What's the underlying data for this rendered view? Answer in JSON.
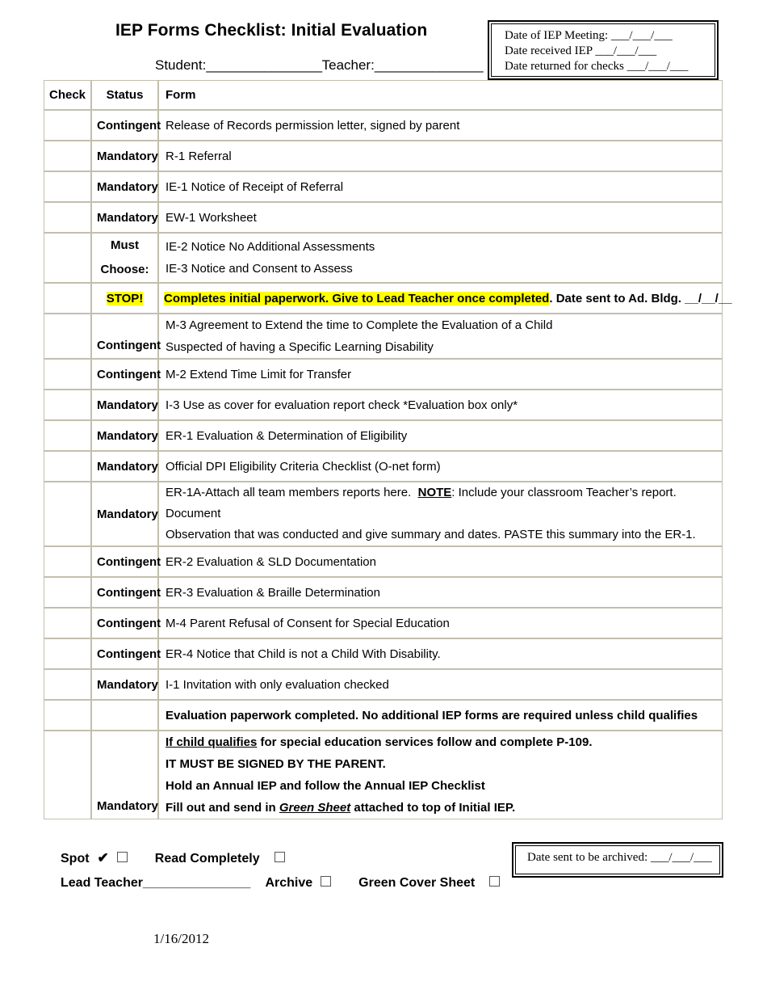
{
  "header": {
    "title": "IEP Forms Checklist: Initial Evaluation",
    "student_label": "Student:",
    "student_blank": "________________",
    "teacher_label": "Teacher:",
    "teacher_blank": "_______________"
  },
  "date_box": {
    "line1_label": "Date of IEP Meeting:",
    "line1_blank": "___/___/___",
    "line2_label": "Date received IEP",
    "line2_blank": "___/___/___",
    "line3_label": "Date returned for checks",
    "line3_blank": "___/___/___"
  },
  "table": {
    "headers": {
      "check": "Check",
      "status": "Status",
      "form": "Form"
    },
    "rows": [
      {
        "status": "Contingent",
        "form": "Release of Records permission letter, signed by parent"
      },
      {
        "status": "Mandatory",
        "form": "R-1 Referral"
      },
      {
        "status": "Mandatory",
        "form": "IE-1 Notice of Receipt of Referral"
      },
      {
        "status": "Mandatory",
        "form": "EW-1 Worksheet"
      },
      {
        "status_line1": "Must",
        "status_line2": "Choose:",
        "form_line1": "IE-2 Notice No Additional Assessments",
        "form_line2": "IE-3 Notice and Consent to Assess"
      },
      {
        "status": "STOP!",
        "form_highlight": "Completes initial paperwork. Give to Lead Teacher once completed",
        "form_tail": ". Date sent to Ad. Bldg.  __/__/__"
      },
      {
        "status": "Contingent",
        "form_line1": "M-3 Agreement to Extend the time to Complete the Evaluation of a Child",
        "form_line2": "Suspected of having a Specific Learning Disability"
      },
      {
        "status": "Contingent",
        "form": "M-2 Extend Time Limit for Transfer"
      },
      {
        "status": "Mandatory",
        "form": "I-3 Use as cover for evaluation report check *Evaluation box only*"
      },
      {
        "status": "Mandatory",
        "form": "ER-1 Evaluation & Determination of Eligibility"
      },
      {
        "status": "Mandatory",
        "form": "Official DPI Eligibility Criteria Checklist (O-net form)"
      },
      {
        "status": "Mandatory",
        "form_a1": "ER-1A-Attach all team members reports here.",
        "form_note": "NOTE",
        "form_a2": ": Include your classroom Teacher’s report.  Document",
        "form_a3": "Observation that was conducted and give summary and dates.  PASTE this summary into the ER-1."
      },
      {
        "status": "Contingent",
        "form": "ER-2 Evaluation & SLD Documentation"
      },
      {
        "status": "Contingent",
        "form": "ER-3 Evaluation & Braille Determination"
      },
      {
        "status": "Contingent",
        "form": "M-4 Parent Refusal of Consent for Special Education"
      },
      {
        "status": "Contingent",
        "form": " ER-4 Notice that Child is not a Child With Disability."
      },
      {
        "status": "Mandatory",
        "form": "I-1 Invitation with only evaluation checked"
      },
      {
        "status": "",
        "form": "Evaluation paperwork completed. No additional IEP forms are required unless child qualifies"
      },
      {
        "status": "Mandatory",
        "final_l1_u": "If child qualifies",
        "final_l1_rest": " for special education services follow and complete P-109.",
        "final_l2": "IT MUST BE SIGNED BY THE PARENT.",
        "final_l3": "Hold an Annual IEP and follow the Annual IEP Checklist",
        "final_l4_a": "Fill out and send in ",
        "final_l4_em": "Green Sheet",
        "final_l4_b": " attached to top of Initial IEP."
      }
    ]
  },
  "footer": {
    "spot_label": "Spot",
    "spot_tick": "✔",
    "read_completely_label": "Read Completely",
    "lead_teacher_label": "Lead Teacher",
    "lead_teacher_blank": "_______________",
    "archive_label": "Archive",
    "green_cover_sheet_label": "Green Cover Sheet"
  },
  "archive_box": {
    "label": "Date sent to be archived:",
    "blank": "___/___/___"
  },
  "doc_date": "1/16/2012",
  "colors": {
    "highlight": "#ffff00",
    "table_border": "#c3bfae",
    "text": "#000000"
  }
}
